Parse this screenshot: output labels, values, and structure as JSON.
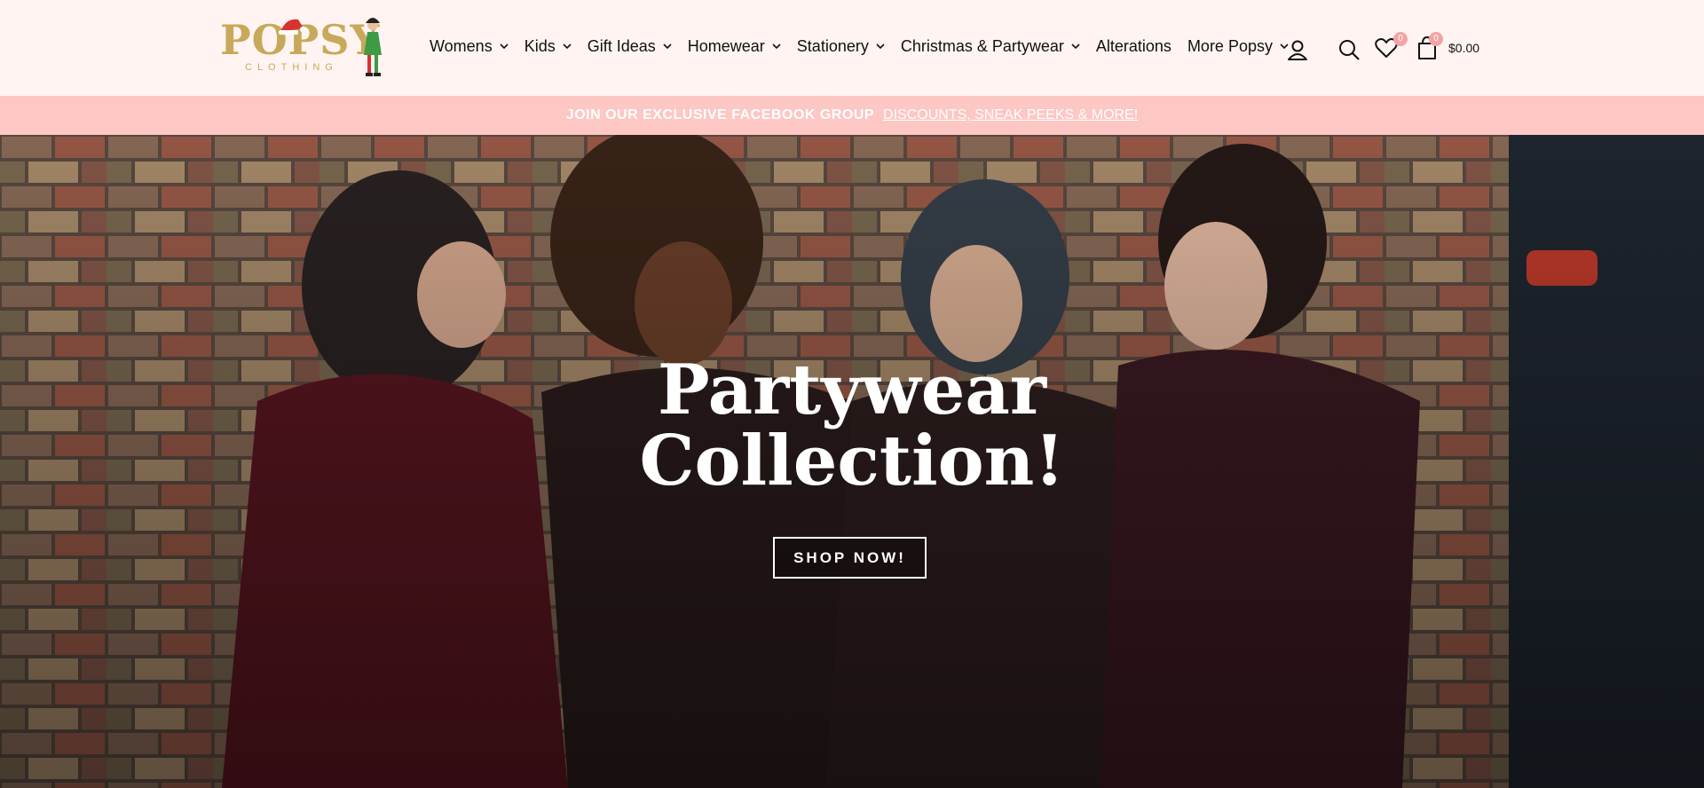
{
  "brand": {
    "logo_text": "POPSY",
    "logo_subtext": "CLOTHING",
    "accent": "#c8a95a"
  },
  "nav": {
    "items": [
      {
        "label": "Womens",
        "has_dropdown": true
      },
      {
        "label": "Kids",
        "has_dropdown": true
      },
      {
        "label": "Gift Ideas",
        "has_dropdown": true
      },
      {
        "label": "Homewear",
        "has_dropdown": true
      },
      {
        "label": "Stationery",
        "has_dropdown": true
      },
      {
        "label": "Christmas & Partywear",
        "has_dropdown": true
      },
      {
        "label": "Alterations",
        "has_dropdown": false
      },
      {
        "label": "More Popsy",
        "has_dropdown": true
      }
    ]
  },
  "header_icons": {
    "account": "user-icon",
    "search": "search-icon",
    "wishlist": "heart-icon",
    "wishlist_count": "0",
    "cart": "bag-icon",
    "cart_count": "0",
    "cart_total": "$0.00"
  },
  "announcement": {
    "bold_text": "JOIN OUR EXCLUSIVE FACEBOOK GROUP",
    "link_text": "DISCOUNTS, SNEAK PEEKS & MORE!",
    "background": "#fdc7c4"
  },
  "hero": {
    "title_line1": "Partywear",
    "title_line2": "Collection!",
    "cta_label": "SHOP NOW!"
  }
}
